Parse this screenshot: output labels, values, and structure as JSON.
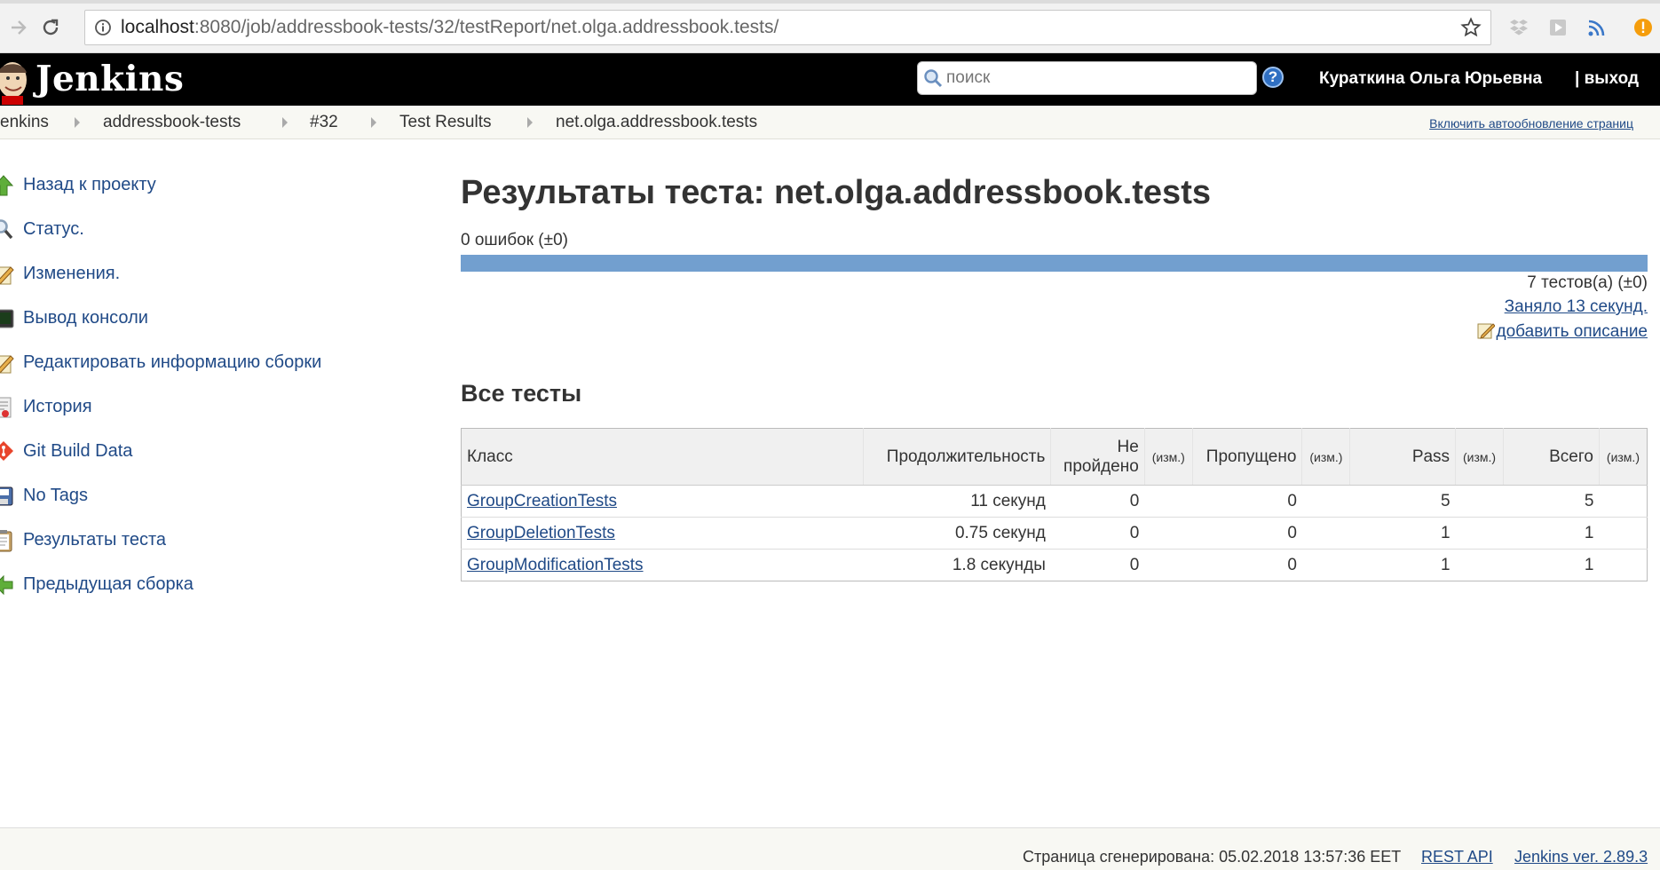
{
  "browser": {
    "url_host": "localhost",
    "url_rest": ":8080/job/addressbook-tests/32/testReport/net.olga.addressbook.tests/"
  },
  "header": {
    "logo_text": "Jenkins",
    "search_placeholder": "поиск",
    "help_label": "?",
    "user_name": "Кураткина Ольга Юрьевна",
    "logout_label": "| выход"
  },
  "breadcrumbs": {
    "items": [
      "enkins",
      "addressbook-tests",
      "#32",
      "Test Results",
      "net.olga.addressbook.tests"
    ],
    "autorefresh": "Включить автообновление страниц"
  },
  "sidebar": {
    "items": [
      {
        "label": "Назад к проекту",
        "icon": "up-arrow-icon"
      },
      {
        "label": "Статус.",
        "icon": "magnifier-icon"
      },
      {
        "label": "Изменения.",
        "icon": "notepad-icon"
      },
      {
        "label": "Вывод консоли",
        "icon": "terminal-icon"
      },
      {
        "label": "Редактировать информацию сборки",
        "icon": "notepad-pencil-icon"
      },
      {
        "label": "История",
        "icon": "history-icon"
      },
      {
        "label": "Git Build Data",
        "icon": "git-icon"
      },
      {
        "label": "No Tags",
        "icon": "save-icon"
      },
      {
        "label": "Результаты теста",
        "icon": "clipboard-icon"
      },
      {
        "label": "Предыдущая сборка",
        "icon": "previous-icon"
      }
    ]
  },
  "main": {
    "title": "Результаты теста: net.olga.addressbook.tests",
    "failures": "0 ошибок (±0)",
    "pass_fraction": 1.0,
    "tests_count": "7 тестов(а) (±0)",
    "duration": "Заняло 13 секунд.",
    "add_description": "добавить описание",
    "section_title": "Все тесты",
    "table": {
      "headers": {
        "class": "Класс",
        "duration": "Продолжительность",
        "failed": "Не пройдено",
        "diff": "(изм.)",
        "skipped": "Пропущено",
        "pass": "Pass",
        "total": "Всего"
      },
      "rows": [
        {
          "class": "GroupCreationTests",
          "duration": "11 секунд",
          "failed": "0",
          "skipped": "0",
          "pass": "5",
          "total": "5"
        },
        {
          "class": "GroupDeletionTests",
          "duration": "0.75 секунд",
          "failed": "0",
          "skipped": "0",
          "pass": "1",
          "total": "1"
        },
        {
          "class": "GroupModificationTests",
          "duration": "1.8 секунды",
          "failed": "0",
          "skipped": "0",
          "pass": "1",
          "total": "1"
        }
      ]
    }
  },
  "footer": {
    "generated": "Страница сгенерирована: 05.02.2018 13:57:36 EET",
    "rest_api": "REST API",
    "version": "Jenkins ver. 2.89.3"
  },
  "colors": {
    "header_bg": "#000000",
    "link": "#204a87",
    "pass_bar": "#729fcf",
    "crumb_bg": "#f8f8f3"
  }
}
